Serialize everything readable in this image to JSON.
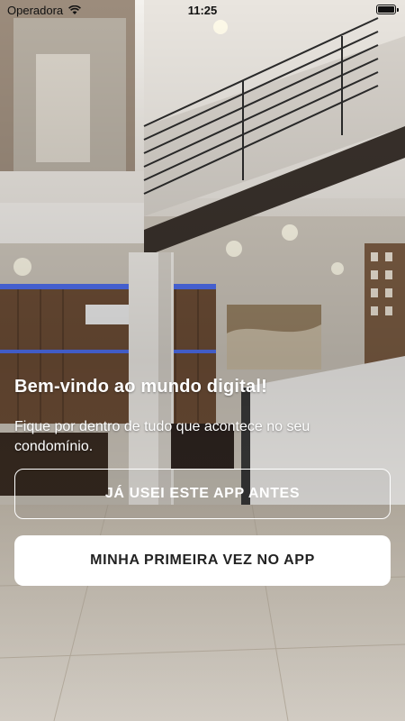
{
  "status_bar": {
    "carrier": "Operadora",
    "time": "11:25",
    "wifi_icon": "wifi-icon",
    "battery_icon": "battery-icon"
  },
  "welcome": {
    "title": "Bem-vindo ao mundo digital!",
    "subtitle": "Fique por dentro de tudo que acontece no seu condomínio."
  },
  "actions": {
    "existing_user_label": "JÁ USEI ESTE APP ANTES",
    "first_time_label": "MINHA PRIMEIRA VEZ NO APP"
  }
}
